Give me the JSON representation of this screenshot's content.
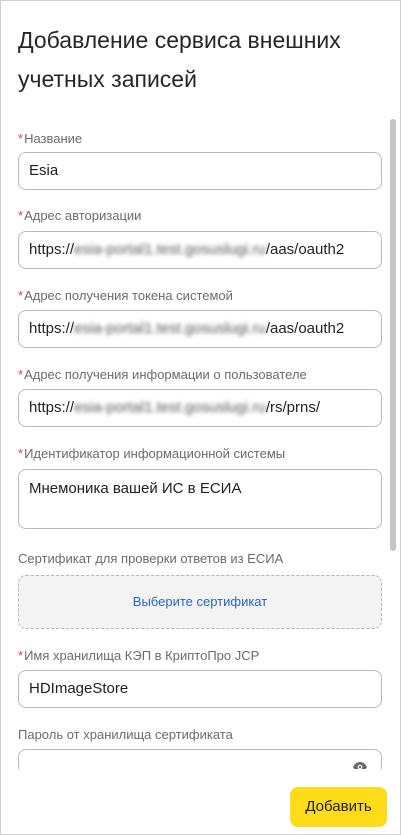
{
  "dialog": {
    "title": "Добавление сервиса внешних учетных записей"
  },
  "form": {
    "required_mark": "*",
    "name": {
      "label": "Название",
      "value": "Esia"
    },
    "auth_url": {
      "label": "Адрес авторизации",
      "value_prefix": "https://",
      "value_hidden": "esia-portal1.test.gosuslugi.ru",
      "value_suffix": "/aas/oauth2"
    },
    "token_url": {
      "label": "Адрес получения токена системой",
      "value_prefix": "https://",
      "value_hidden": "esia-portal1.test.gosuslugi.ru",
      "value_suffix": "/aas/oauth2"
    },
    "userinfo_url": {
      "label": "Адрес получения информации о пользователе",
      "value_prefix": "https://",
      "value_hidden": "esia-portal1.test.gosuslugi.ru",
      "value_suffix": "/rs/prns/"
    },
    "system_id": {
      "label": "Идентификатор информационной системы",
      "value": "Мнемоника вашей ИС в ЕСИА"
    },
    "certificate": {
      "label": "Сертификат для проверки ответов из ЕСИА",
      "action": "Выберите сертификат"
    },
    "keystore": {
      "label": "Имя хранилища КЭП в КриптоПро JCP",
      "value": "HDImageStore"
    },
    "store_password": {
      "label": "Пароль от хранилища сертификата",
      "value": ""
    }
  },
  "footer": {
    "add_label": "Добавить"
  },
  "colors": {
    "accent_button": "#ffdb1a",
    "required": "#e2463b",
    "link": "#2a64c8"
  },
  "icons": {
    "password_toggle": "eye-icon"
  }
}
